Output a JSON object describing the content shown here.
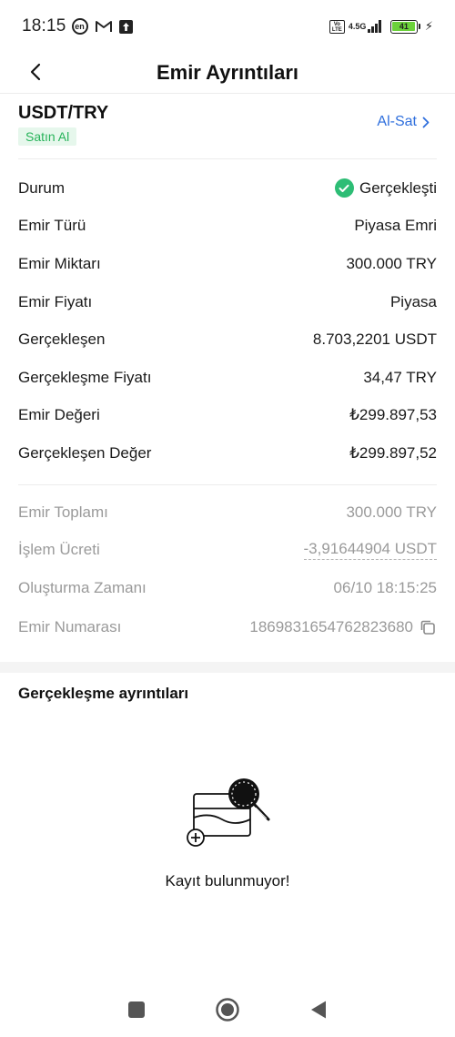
{
  "status_bar": {
    "time": "18:15",
    "lang_badge": "en",
    "network": "4.5G",
    "volte": "Vo LTE",
    "battery": "41",
    "icons": [
      "en-icon",
      "mail-icon",
      "upload-icon",
      "volte-icon",
      "signal-icon",
      "battery-icon",
      "charging-icon"
    ]
  },
  "header": {
    "title": "Emir Ayrıntıları",
    "back_icon": "chevron-left-icon"
  },
  "pair": {
    "name": "USDT/TRY",
    "side": "Satın Al",
    "trade_link": "Al-Sat"
  },
  "details": [
    {
      "label": "Durum",
      "value": "Gerçekleşti"
    },
    {
      "label": "Emir Türü",
      "value": "Piyasa Emri"
    },
    {
      "label": "Emir Miktarı",
      "value": "300.000 TRY"
    },
    {
      "label": "Emir Fiyatı",
      "value": "Piyasa"
    },
    {
      "label": "Gerçekleşen",
      "value": "8.703,2201 USDT"
    },
    {
      "label": "Gerçekleşme Fiyatı",
      "value": "34,47 TRY"
    },
    {
      "label": "Emir Değeri",
      "value": "₺299.897,53"
    },
    {
      "label": "Gerçekleşen Değer",
      "value": "₺299.897,52"
    }
  ],
  "meta": [
    {
      "label": "Emir Toplamı",
      "value": "300.000 TRY"
    },
    {
      "label": "İşlem Ücreti",
      "value": "-3,91644904 USDT"
    },
    {
      "label": "Oluşturma Zamanı",
      "value": "06/10 18:15:25"
    },
    {
      "label": "Emir Numarası",
      "value": "1869831654762823680"
    }
  ],
  "fills": {
    "title": "Gerçekleşme ayrıntıları",
    "empty_text": "Kayıt bulunmuyor!"
  },
  "colors": {
    "accent": "#2f6fdd",
    "success": "#2dbd75",
    "buy_badge_bg": "#e6f7ec",
    "buy_badge_text": "#27b35a",
    "muted": "#9a9a9a"
  },
  "nav": {
    "icons": [
      "recents-square-icon",
      "home-circle-icon",
      "back-triangle-icon"
    ]
  }
}
